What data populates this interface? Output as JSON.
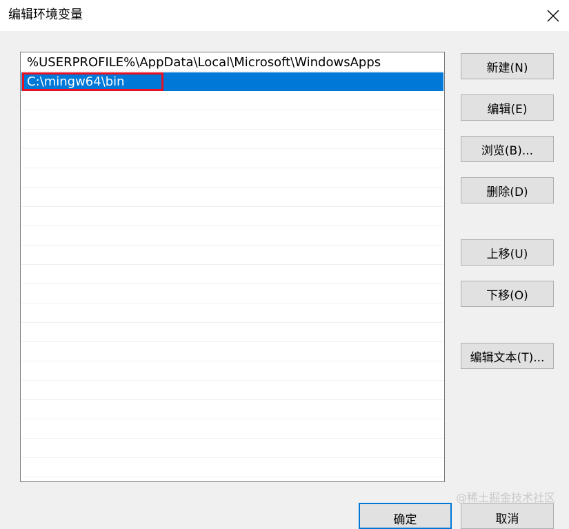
{
  "window": {
    "title": "编辑环境变量",
    "close_icon": "close-icon"
  },
  "path_list": {
    "items": [
      "%USERPROFILE%\\AppData\\Local\\Microsoft\\WindowsApps",
      "C:\\mingw64\\bin"
    ],
    "selected_index": 1,
    "highlight_color": "#e81123",
    "selection_color": "#0078d7"
  },
  "buttons": {
    "new": "新建(N)",
    "edit": "编辑(E)",
    "browse": "浏览(B)...",
    "delete": "删除(D)",
    "move_up": "上移(U)",
    "move_down": "下移(O)",
    "edit_text": "编辑文本(T)..."
  },
  "footer": {
    "ok": "确定",
    "cancel": "取消"
  },
  "watermark": "@稀土掘金技术社区"
}
